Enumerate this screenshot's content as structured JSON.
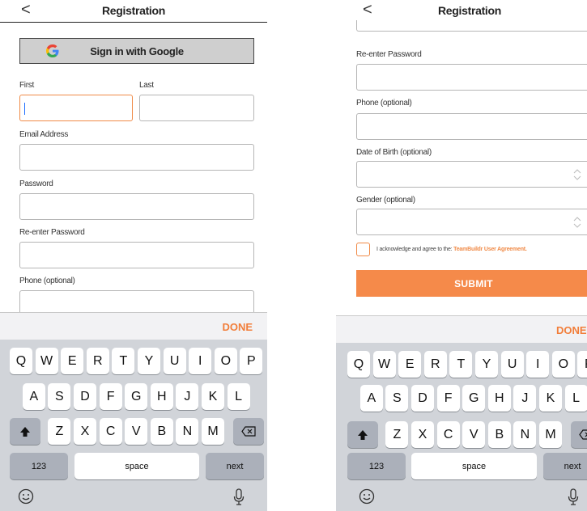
{
  "left": {
    "nav": {
      "back": "<",
      "title": "Registration"
    },
    "google_button": {
      "icon": "G",
      "label": "Sign in with Google"
    },
    "labels": {
      "first": "First",
      "last": "Last",
      "email": "Email Address",
      "password": "Password",
      "reenter": "Re-enter Password",
      "phone": "Phone (optional)"
    },
    "keyboard": {
      "done": "DONE",
      "numbers": "123",
      "space": "space",
      "next": "next"
    }
  },
  "right": {
    "nav": {
      "back": "<",
      "title": "Registration"
    },
    "labels": {
      "reenter": "Re-enter Password",
      "phone": "Phone (optional)",
      "dob": "Date of Birth (optional)",
      "gender": "Gender (optional)"
    },
    "agreement": {
      "text": "I acknowledge and agree to the: ",
      "link": "TeamBuildr User Agreement."
    },
    "submit": "SUBMIT",
    "keyboard": {
      "done": "DONE",
      "numbers": "123",
      "space": "space",
      "next": "next"
    }
  },
  "keys": {
    "row1": [
      "Q",
      "W",
      "E",
      "R",
      "T",
      "Y",
      "U",
      "I",
      "O",
      "P"
    ],
    "row2": [
      "A",
      "S",
      "D",
      "F",
      "G",
      "H",
      "J",
      "K",
      "L"
    ],
    "row3": [
      "Z",
      "X",
      "C",
      "V",
      "B",
      "N",
      "M"
    ]
  },
  "colors": {
    "accent": "#f58a4a",
    "keyboard_bg": "#d1d4d9",
    "google_btn_bg": "#cfcfcf"
  }
}
